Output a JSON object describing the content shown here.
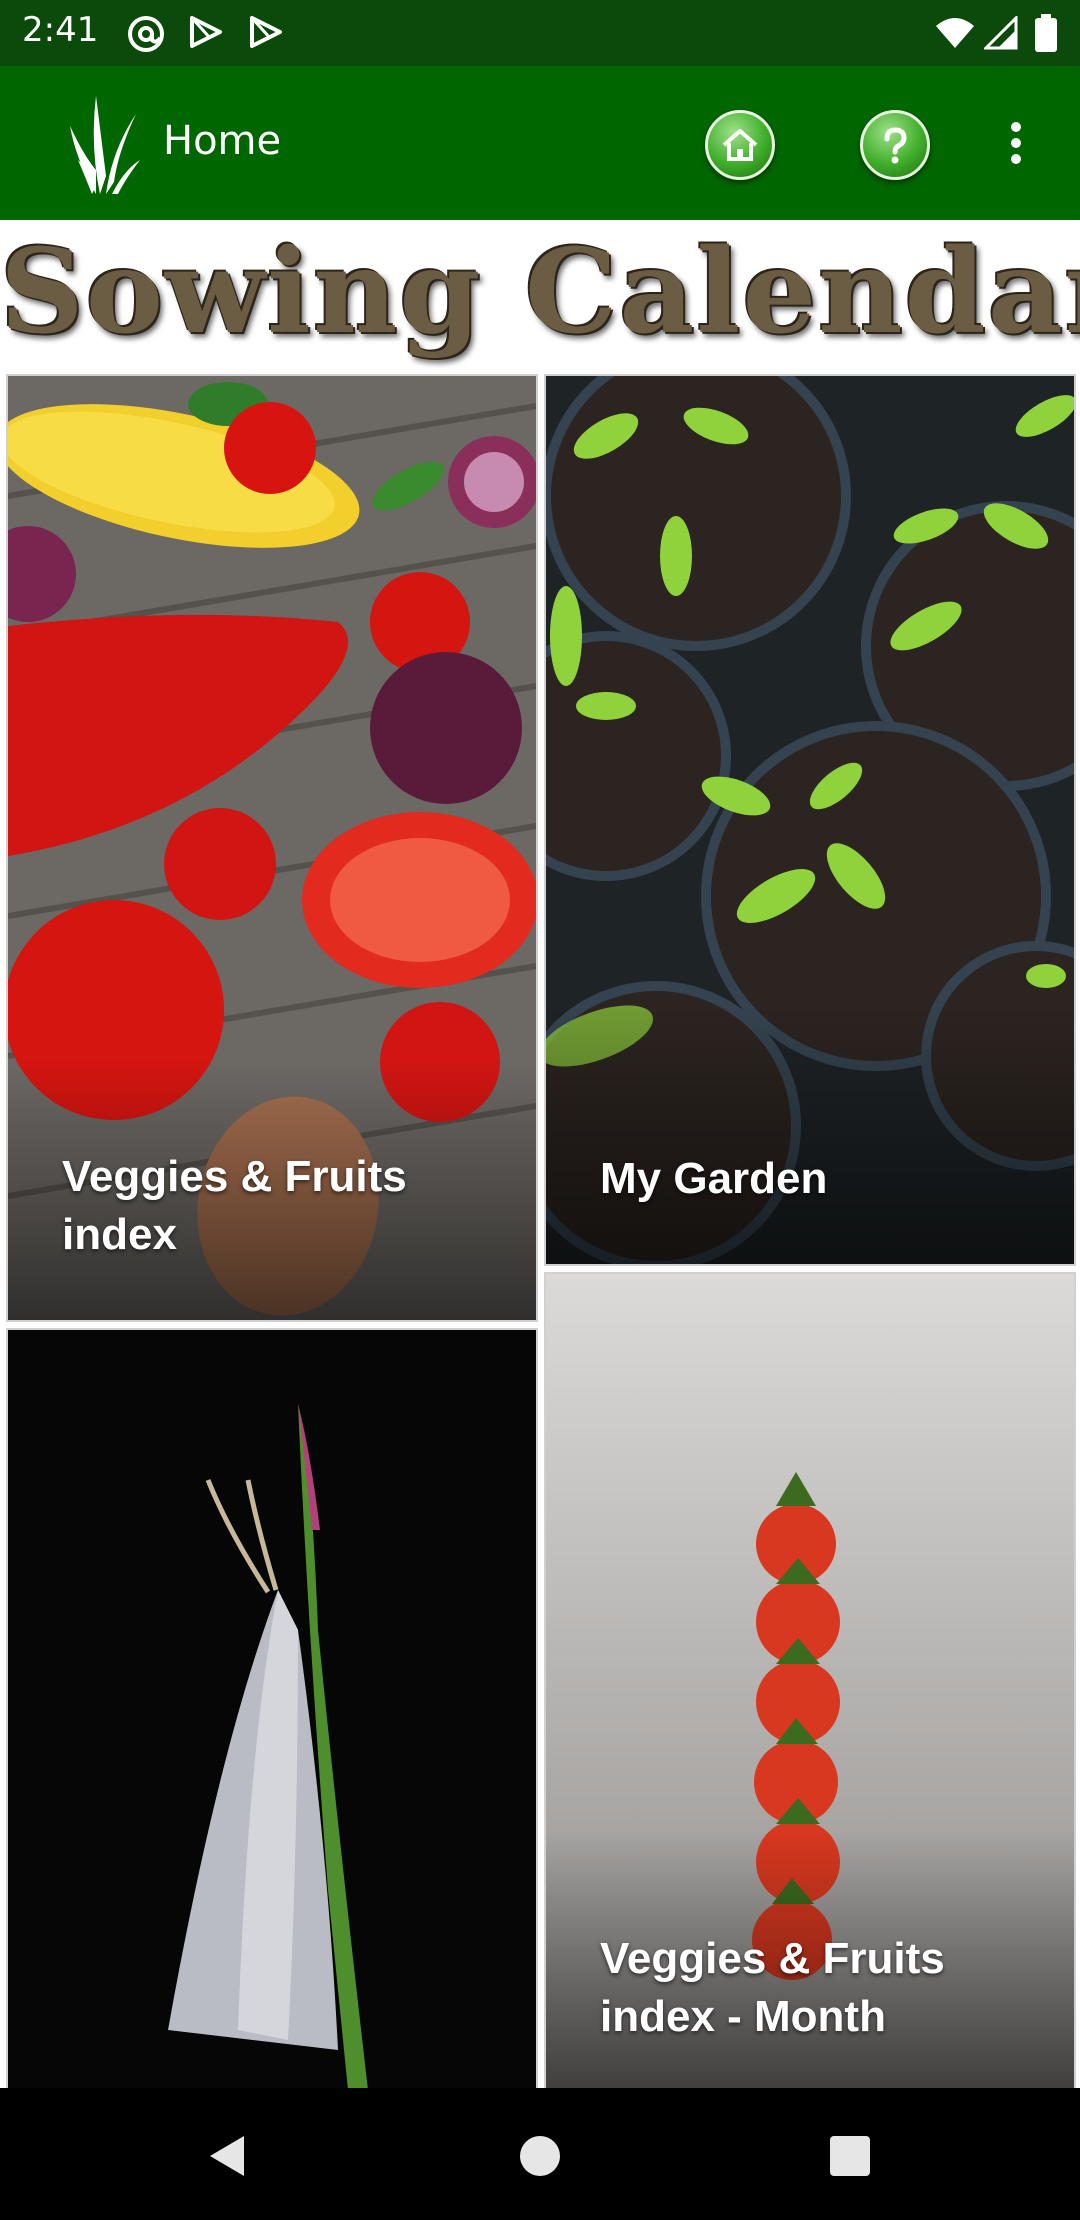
{
  "status_bar": {
    "time": "2:41",
    "left_icons": [
      "at-sign-icon",
      "play-store-icon",
      "play-store-icon"
    ],
    "right_icons": [
      "wifi-icon",
      "cellular-signal-icon",
      "battery-icon"
    ]
  },
  "app_bar": {
    "title": "Home",
    "logo_icon": "grass-logo-icon",
    "actions": [
      "home-icon",
      "help-icon",
      "more-vert-icon"
    ],
    "background_color": "#006600"
  },
  "banner": {
    "title": "Sowing Calendar"
  },
  "tiles": [
    {
      "label": "Veggies & Fruits index",
      "image": "vegetables-photo"
    },
    {
      "label": "My Garden",
      "image": "seedlings-photo"
    },
    {
      "label": "",
      "image": "moth-on-grass-photo"
    },
    {
      "label": "Veggies & Fruits index - Month",
      "image": "cherry-tomatoes-photo"
    }
  ],
  "nav_bar": {
    "buttons": [
      "back-icon",
      "home-circle-icon",
      "recents-square-icon"
    ]
  }
}
